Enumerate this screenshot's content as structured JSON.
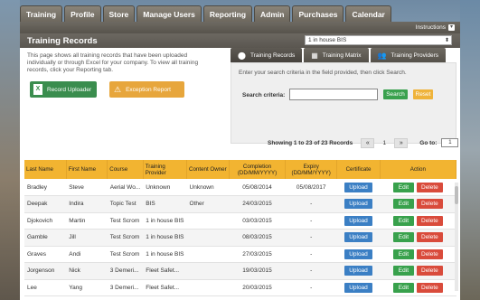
{
  "nav": {
    "tabs": [
      "Training",
      "Profile",
      "Store",
      "Manage Users",
      "Reporting",
      "Admin",
      "Purchases",
      "Calendar"
    ]
  },
  "topbar": {
    "instructions": "Instructions"
  },
  "page": {
    "title": "Training Records",
    "provider_value": "1 in house BIS",
    "intro": "This page shows all training records that have been uploaded individually or through Excel for your company. To view all training records, click your Reporting tab."
  },
  "actions": {
    "record_uploader": "Record Uploader",
    "exception_report": "Exception Report"
  },
  "right_tabs": [
    "Training Records",
    "Training Matrix",
    "Training Providers"
  ],
  "search": {
    "hint": "Enter your search criteria in the field provided, then click Search.",
    "label": "Search criteria:",
    "value": "",
    "search_label": "Search",
    "reset_label": "Reset"
  },
  "pager": {
    "showing": "Showing 1 to 23 of 23 Records",
    "page": "1",
    "goto": "Go to:",
    "goto_value": "1"
  },
  "table": {
    "headers": [
      "Last Name",
      "First Name",
      "Course",
      "Training Provider",
      "Content Owner",
      "Completion (DD/MM/YYYY)",
      "Expiry (DD/MM/YYYY)",
      "Certificate",
      "Action"
    ],
    "upload_label": "Upload",
    "edit_label": "Edit",
    "delete_label": "Delete",
    "rows": [
      [
        "Bradley",
        "Steve",
        "Aerial Wo...",
        "Unknown",
        "Unknown",
        "05/08/2014",
        "05/08/2017"
      ],
      [
        "Deepak",
        "Indira",
        "Topic Test",
        "BIS",
        "Other",
        "24/03/2015",
        "-"
      ],
      [
        "Djokovich",
        "Martin",
        "Test Scrom",
        "1 in house BIS",
        "",
        "03/03/2015",
        "-"
      ],
      [
        "Gamble",
        "Jill",
        "Test Scrom",
        "1 in house BIS",
        "",
        "08/03/2015",
        "-"
      ],
      [
        "Graves",
        "Andi",
        "Test Scrom",
        "1 in house BIS",
        "",
        "27/03/2015",
        "-"
      ],
      [
        "Jorgenson",
        "Nick",
        "3 Demeri...",
        "Fleet Safet...",
        "",
        "19/03/2015",
        "-"
      ],
      [
        "Lee",
        "Yang",
        "3 Demeri...",
        "Fleet Safet...",
        "",
        "20/03/2015",
        "-"
      ]
    ]
  }
}
